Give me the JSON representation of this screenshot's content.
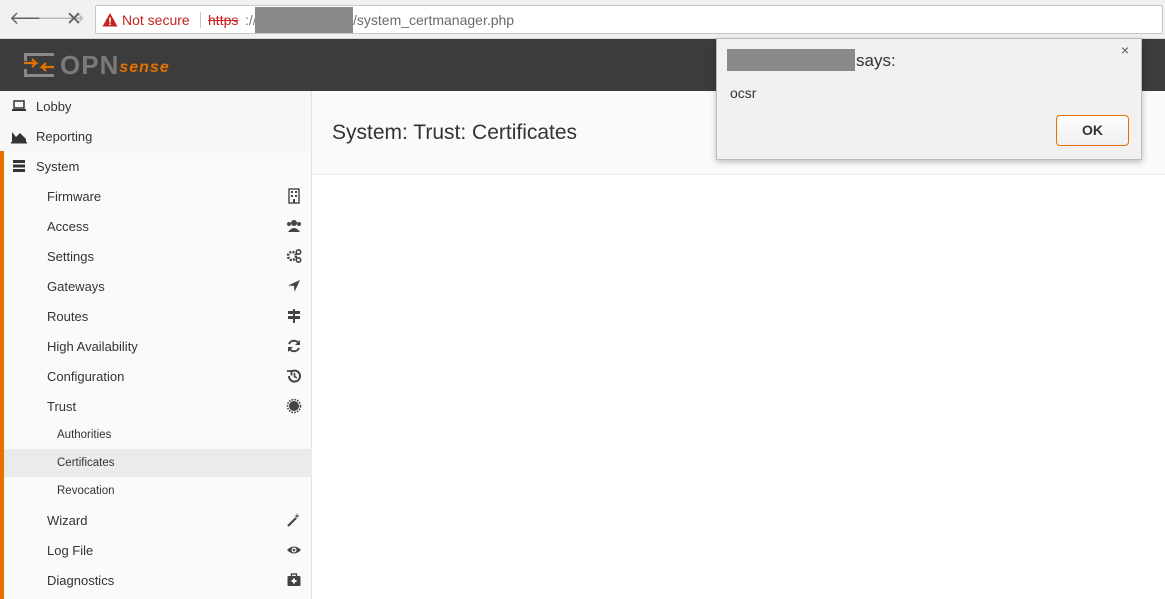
{
  "browser": {
    "back_glyph": "🡐",
    "forward_glyph": "🡒",
    "stop_glyph": "✕",
    "security_label": "Not secure",
    "url_scheme": "https",
    "url_separator": "://",
    "url_path": "/system_certmanager.php",
    "warning_icon": "warning-triangle-icon"
  },
  "header": {
    "logo_text": "OPN",
    "logo_accent": "sense"
  },
  "sidebar": {
    "top_items": [
      {
        "label": "Lobby",
        "icon": "laptop-icon"
      },
      {
        "label": "Reporting",
        "icon": "area-chart-icon"
      },
      {
        "label": "System",
        "icon": "server-icon"
      }
    ],
    "system_items": [
      {
        "label": "Firmware",
        "icon": "building-icon"
      },
      {
        "label": "Access",
        "icon": "users-icon"
      },
      {
        "label": "Settings",
        "icon": "cogs-icon"
      },
      {
        "label": "Gateways",
        "icon": "location-arrow-icon"
      },
      {
        "label": "Routes",
        "icon": "map-signs-icon"
      },
      {
        "label": "High Availability",
        "icon": "refresh-icon"
      },
      {
        "label": "Configuration",
        "icon": "history-icon"
      },
      {
        "label": "Trust",
        "icon": "certificate-icon"
      }
    ],
    "trust_items": [
      {
        "label": "Authorities",
        "active": false
      },
      {
        "label": "Certificates",
        "active": true
      },
      {
        "label": "Revocation",
        "active": false
      }
    ],
    "more_items": [
      {
        "label": "Wizard",
        "icon": "magic-icon"
      },
      {
        "label": "Log File",
        "icon": "eye-icon"
      },
      {
        "label": "Diagnostics",
        "icon": "medkit-icon"
      }
    ]
  },
  "main": {
    "page_title": "System: Trust: Certificates"
  },
  "dialog": {
    "says_label": "says:",
    "message": "ocsr",
    "ok_label": "OK",
    "close_glyph": "×"
  },
  "colors": {
    "accent": "#e57100",
    "header_bg": "#3c3c3c",
    "danger": "#c5221f"
  }
}
